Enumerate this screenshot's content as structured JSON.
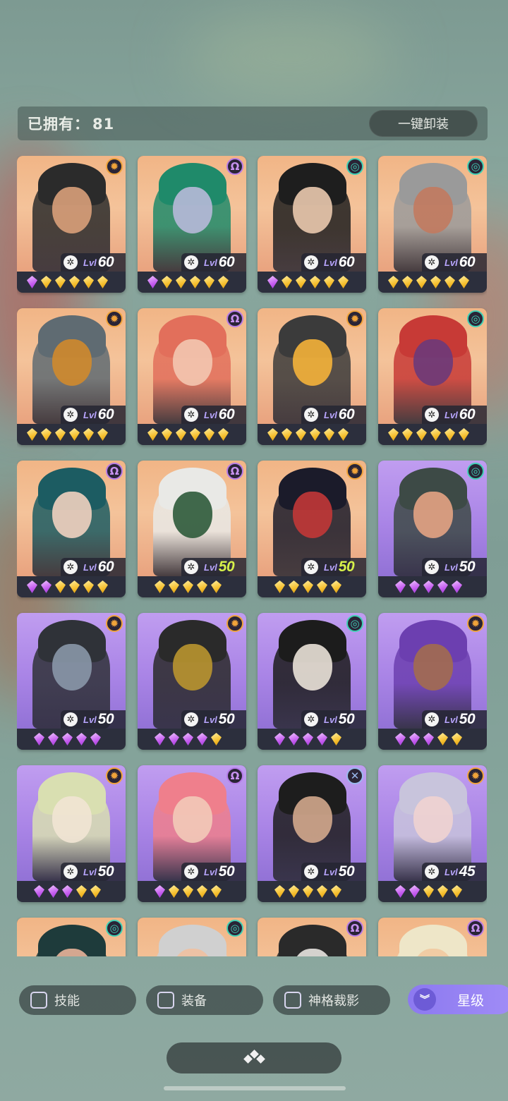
{
  "header": {
    "owned_label": "已拥有：",
    "owned_count": "81",
    "unequip_label": "一键卸装"
  },
  "filters": [
    {
      "label": "技能",
      "checked": false
    },
    {
      "label": "装备",
      "checked": false
    },
    {
      "label": "神格裁影",
      "checked": false
    }
  ],
  "sort_button": {
    "label": "星级",
    "icon": "chevron-double-down-icon"
  },
  "bottom_button": {
    "icon": "diamond-cluster-icon"
  },
  "colors": {
    "accent": "#8c79f0",
    "level_gold": "#ffffff",
    "level_green": "#d7f14a"
  },
  "cards": [
    {
      "element": "sun",
      "bg": "orange",
      "level": "60",
      "gems": [
        "p",
        "g",
        "g",
        "g",
        "g",
        "g"
      ],
      "tone": [
        "#2b2b2b",
        "#d9a07a"
      ]
    },
    {
      "element": "void",
      "bg": "orange",
      "level": "60",
      "gems": [
        "p",
        "g",
        "g",
        "g",
        "g",
        "g"
      ],
      "tone": [
        "#1f8a6a",
        "#b7b9d9"
      ]
    },
    {
      "element": "wind",
      "bg": "orange",
      "level": "60",
      "gems": [
        "p",
        "g",
        "g",
        "g",
        "g",
        "g"
      ],
      "tone": [
        "#1e1e1e",
        "#eac9ae"
      ]
    },
    {
      "element": "wind",
      "bg": "orange",
      "level": "60",
      "gems": [
        "g",
        "g",
        "g",
        "g",
        "g",
        "g"
      ],
      "tone": [
        "#9a9a9a",
        "#c27a5f"
      ]
    },
    {
      "element": "sun",
      "bg": "orange",
      "level": "60",
      "gems": [
        "g",
        "g",
        "g",
        "g",
        "g",
        "g"
      ],
      "tone": [
        "#5f6b72",
        "#d08a2c"
      ]
    },
    {
      "element": "void",
      "bg": "orange",
      "level": "60",
      "gems": [
        "g",
        "g",
        "g",
        "g",
        "g",
        "g"
      ],
      "tone": [
        "#e26f5b",
        "#f3c7b0"
      ]
    },
    {
      "element": "sun",
      "bg": "orange",
      "level": "60",
      "gems": [
        "g",
        "g",
        "g",
        "g",
        "g",
        "g"
      ],
      "tone": [
        "#3b3b3b",
        "#f5b23a"
      ]
    },
    {
      "element": "wind",
      "bg": "orange",
      "level": "60",
      "gems": [
        "g",
        "g",
        "g",
        "g",
        "g",
        "g"
      ],
      "tone": [
        "#c73a36",
        "#6b3a7a"
      ]
    },
    {
      "element": "void",
      "bg": "orange",
      "level": "60",
      "gems": [
        "p",
        "p",
        "g",
        "g",
        "g",
        "g"
      ],
      "tone": [
        "#1c5c62",
        "#f1d1c0"
      ]
    },
    {
      "element": "void",
      "bg": "orange",
      "level": "50",
      "gems": [
        "g",
        "g",
        "g",
        "g",
        "g"
      ],
      "tone": [
        "#e9e9e6",
        "#2d5a3a"
      ]
    },
    {
      "element": "sun",
      "bg": "orange",
      "level": "50",
      "gems": [
        "g",
        "g",
        "g",
        "g",
        "g"
      ],
      "tone": [
        "#1b1b2a",
        "#c23737"
      ]
    },
    {
      "element": "wind",
      "bg": "purple",
      "level": "50",
      "gems": [
        "p",
        "p",
        "p",
        "p",
        "p"
      ],
      "tone": [
        "#3d4a46",
        "#e4a383"
      ]
    },
    {
      "element": "sun",
      "bg": "purple",
      "level": "50",
      "gems": [
        "p",
        "p",
        "p",
        "p",
        "p"
      ],
      "tone": [
        "#2f3238",
        "#8a97a8"
      ]
    },
    {
      "element": "sun",
      "bg": "purple",
      "level": "50",
      "gems": [
        "p",
        "p",
        "p",
        "p",
        "g"
      ],
      "tone": [
        "#2a2a2a",
        "#b9952f"
      ]
    },
    {
      "element": "wind",
      "bg": "purple",
      "level": "50",
      "gems": [
        "p",
        "p",
        "p",
        "p",
        "g"
      ],
      "tone": [
        "#1c1c1c",
        "#eae2d8"
      ]
    },
    {
      "element": "sun",
      "bg": "purple",
      "level": "50",
      "gems": [
        "p",
        "p",
        "p",
        "g",
        "g"
      ],
      "tone": [
        "#6c3fb0",
        "#a36b4f"
      ]
    },
    {
      "element": "sun",
      "bg": "purple",
      "level": "50",
      "gems": [
        "p",
        "p",
        "p",
        "g",
        "g"
      ],
      "tone": [
        "#d9dfb1",
        "#f1e4d4"
      ]
    },
    {
      "element": "void",
      "bg": "purple",
      "level": "50",
      "gems": [
        "p",
        "g",
        "g",
        "g",
        "g"
      ],
      "tone": [
        "#ef7f8c",
        "#f2cab8"
      ]
    },
    {
      "element": "x",
      "bg": "purple",
      "level": "50",
      "gems": [
        "g",
        "g",
        "g",
        "g",
        "g"
      ],
      "tone": [
        "#1d1d1d",
        "#d3a88d"
      ]
    },
    {
      "element": "sun",
      "bg": "purple",
      "level": "45",
      "gems": [
        "p",
        "p",
        "g",
        "g",
        "g"
      ],
      "tone": [
        "#c8c4dc",
        "#f0d3d0"
      ]
    },
    {
      "element": "wind",
      "bg": "orange",
      "level": "",
      "gems": [],
      "tone": [
        "#1e3b3b",
        "#e8b49a"
      ]
    },
    {
      "element": "wind",
      "bg": "orange",
      "level": "",
      "gems": [],
      "tone": [
        "#d0d0d0",
        "#f0c0a0"
      ]
    },
    {
      "element": "void",
      "bg": "orange",
      "level": "",
      "gems": [],
      "tone": [
        "#2a2a2a",
        "#e8e4e0"
      ]
    },
    {
      "element": "void",
      "bg": "orange",
      "level": "",
      "gems": [],
      "tone": [
        "#eee6c8",
        "#f1c9a0"
      ]
    }
  ]
}
